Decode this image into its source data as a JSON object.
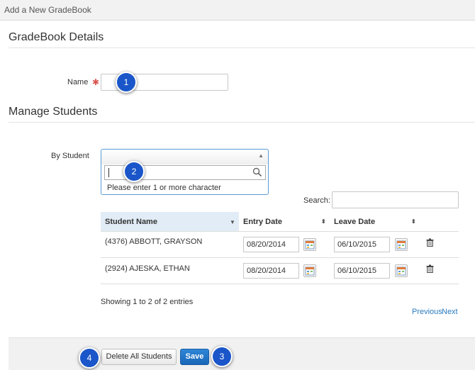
{
  "window": {
    "title": "Add a New GradeBook"
  },
  "details": {
    "heading": "GradeBook Details",
    "name_label": "Name",
    "required_mark": "✱",
    "name_value": ""
  },
  "manage": {
    "heading": "Manage Students",
    "by_student_label": "By Student",
    "dropdown_message": "Please enter 1 or more character"
  },
  "table": {
    "search_label": "Search:",
    "search_value": "",
    "columns": [
      "Student Name",
      "Entry Date",
      "Leave Date"
    ],
    "rows": [
      {
        "name": "(4376) ABBOTT, GRAYSON",
        "entry": "08/20/2014",
        "leave": "06/10/2015"
      },
      {
        "name": "(2924) AJESKA, ETHAN",
        "entry": "08/20/2014",
        "leave": "06/10/2015"
      }
    ],
    "info": "Showing 1 to 2 of 2 entries",
    "previous": "Previous",
    "next": "Next"
  },
  "footer": {
    "delete_all": "Delete All Students",
    "save": "Save"
  },
  "callouts": [
    "1",
    "2",
    "3",
    "4"
  ],
  "colors": {
    "primary": "#1a66b8",
    "badge": "#1a56c9",
    "link": "#2a7bbf",
    "required": "#d9534f",
    "header_highlight": "#e2ecf6"
  }
}
